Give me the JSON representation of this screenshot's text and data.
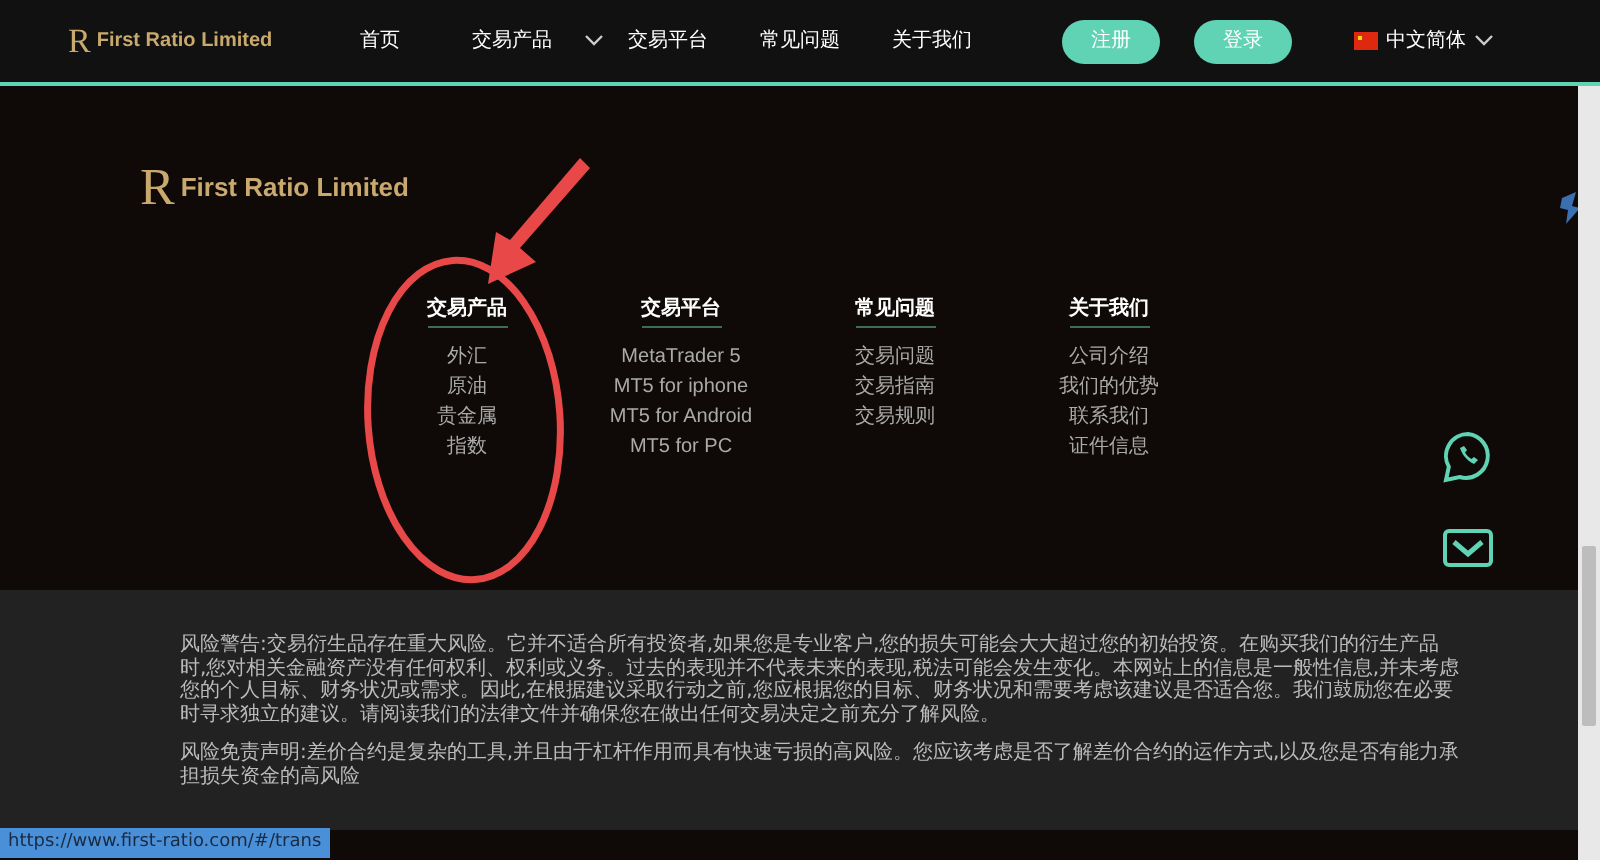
{
  "navbar": {
    "logo_mark": "R",
    "logo": "First Ratio Limited",
    "links": [
      {
        "label": "首页",
        "dropdown": false
      },
      {
        "label": "交易产品",
        "dropdown": true
      },
      {
        "label": "交易平台",
        "dropdown": false
      },
      {
        "label": "常见问题",
        "dropdown": false
      },
      {
        "label": "关于我们",
        "dropdown": false
      }
    ],
    "buttons": [
      "注册",
      "登录"
    ],
    "language": "中文简体"
  },
  "footer": {
    "logo_mark": "R",
    "logo": "First Ratio Limited",
    "columns": [
      {
        "title": "交易产品",
        "links": [
          "外汇",
          "原油",
          "贵金属",
          "指数"
        ]
      },
      {
        "title": "交易平台",
        "links": [
          "MetaTrader 5",
          "MT5 for iphone",
          "MT5 for Android",
          "MT5 for PC"
        ]
      },
      {
        "title": "常见问题",
        "links": [
          "交易问题",
          "交易指南",
          "交易规则"
        ]
      },
      {
        "title": "关于我们",
        "links": [
          "公司介绍",
          "我们的优势",
          "联系我们",
          "证件信息"
        ]
      }
    ]
  },
  "disclaimer": [
    "风险警告:交易衍生品存在重大风险。它并不适合所有投资者,如果您是专业客户,您的损失可能会大大超过您的初始投资。在购买我们的衍生产品时,您对相关金融资产没有任何权利、权利或义务。过去的表现并不代表未来的表现,税法可能会发生变化。本网站上的信息是一般性信息,并未考虑您的个人目标、财务状况或需求。因此,在根据建议采取行动之前,您应根据您的目标、财务状况和需要考虑该建议是否适合您。我们鼓励您在必要时寻求独立的建议。请阅读我们的法律文件并确保您在做出任何交易决定之前充分了解风险。",
    "风险免责声明:差价合约是复杂的工具,并且由于杠杆作用而具有快速亏损的高风险。您应该考虑是否了解差价合约的运作方式,以及您是否有能力承担损失资金的高风险"
  ],
  "status_url": "https://www.first-ratio.com/#/trans",
  "annotation": {
    "kind": "circle-arrow"
  }
}
